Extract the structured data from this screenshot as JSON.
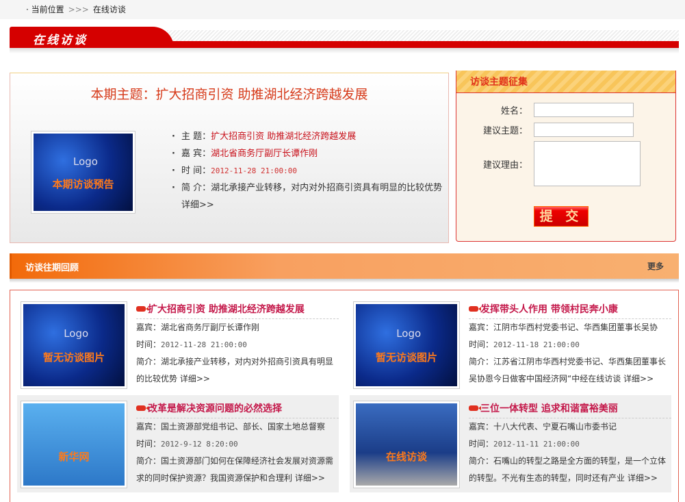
{
  "breadcrumb": {
    "label": "当前位置",
    "sep": ">>>",
    "current": "在线访谈"
  },
  "banner": {
    "title": "在线访谈"
  },
  "current": {
    "heading": "本期主题：扩大招商引资 助推湖北经济跨越发展",
    "image_logo": "Logo",
    "image_caption": "本期访谈预告",
    "topic_label": "主 题：",
    "topic": "扩大招商引资 助推湖北经济跨越发展",
    "guest_label": "嘉 宾：",
    "guest": "湖北省商务厅副厅长谭作刚",
    "time_label": "时 间：",
    "time": "2012-11-28 21:00:00",
    "intro_label": "简 介：",
    "intro": "湖北承接产业转移，对内对外招商引资具有明显的比较优势",
    "more": "详细>>"
  },
  "form": {
    "title": "访谈主题征集",
    "name_label": "姓名：",
    "subject_label": "建议主题：",
    "reason_label": "建议理由：",
    "name_value": "",
    "subject_value": "",
    "reason_value": "",
    "submit": "提 交"
  },
  "past": {
    "title": "访谈往期回顾",
    "more": "更多"
  },
  "items": [
    {
      "title": "扩大招商引资 助推湖北经济跨越发展",
      "guest": "嘉宾：湖北省商务厅副厅长谭作刚",
      "time_label": "时间：",
      "time": "2012-11-28 21:00:00",
      "intro": "简介：湖北承接产业转移，对内对外招商引资具有明显的比较优势",
      "more": "详细>>",
      "img_logo": "Logo",
      "img_caption": "暂无访谈图片"
    },
    {
      "title": "发挥带头人作用 带领村民奔小康",
      "guest": "嘉宾：江阴市华西村党委书记、华西集团董事长吴协",
      "time_label": "时间：",
      "time": "2012-11-18 21:00:00",
      "intro": "简介：江苏省江阴市华西村党委书记、华西集团董事长吴协恩今日做客中国经济网“中经在线访谈",
      "more": "详细>>",
      "img_logo": "Logo",
      "img_caption": "暂无访谈图片"
    },
    {
      "title": "改革是解决资源问题的必然选择",
      "guest": "嘉宾：国土资源部党组书记、部长、国家土地总督察",
      "time_label": "时间：",
      "time": "2012-9-12 8:20:00",
      "intro": "简介：国土资源部门如何在保障经济社会发展对资源需求的同时保护资源？我国资源保护和合理利",
      "more": "详细>>",
      "img_caption": "新华网"
    },
    {
      "title": "三位一体转型 追求和谐富裕美丽",
      "guest": "嘉宾：十八大代表、宁夏石嘴山市委书记",
      "time_label": "时间：",
      "time": "2012-11-11 21:00:00",
      "intro": "简介：石嘴山的转型之路是全方面的转型，是一个立体的转型。不光有生态的转型，同时还有产业",
      "more": "详细>>",
      "img_caption": "在线访谈"
    }
  ]
}
